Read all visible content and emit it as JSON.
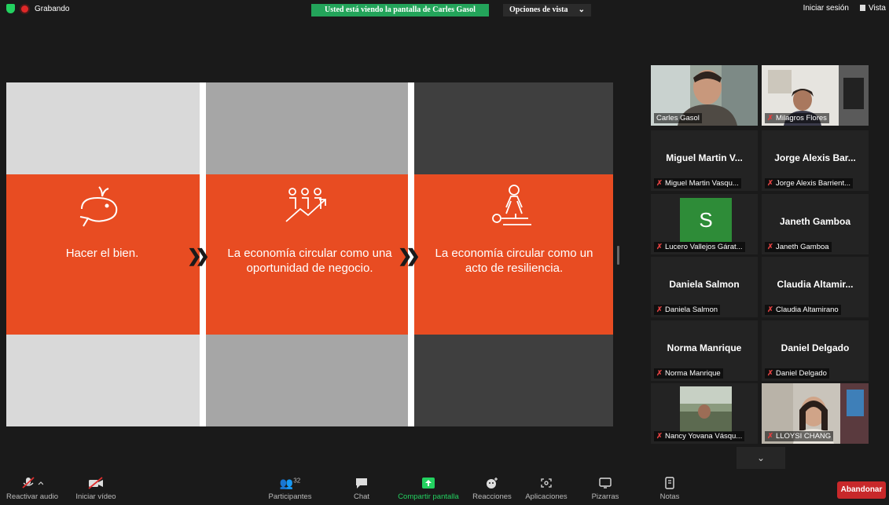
{
  "topbar": {
    "recording_label": "Grabando",
    "banner_text": "Usted está viendo la pantalla de Carles Gasol",
    "view_options_label": "Opciones de vista",
    "view_options_chevron": "⌄",
    "sign_in_label": "Iniciar sesión",
    "vista_label": "Vista"
  },
  "slide": {
    "panels": [
      {
        "text": "Hacer el bien.",
        "icon": "whale-icon"
      },
      {
        "text": "La economía circular como una oportunidad de negocio.",
        "icon": "growth-people-icon"
      },
      {
        "text": "La economía circular como un acto de resiliencia.",
        "icon": "cpr-icon"
      }
    ],
    "separator": "❯❯",
    "colors": {
      "accent": "#e84c22",
      "light": "#d9d9d9",
      "mid": "#a6a6a6",
      "dark": "#3f3f3f"
    }
  },
  "participants": [
    {
      "display": "",
      "label": "Carles Gasol",
      "video": true,
      "active": true
    },
    {
      "display": "",
      "label": "Milagros Flores",
      "video": true,
      "muted": true
    },
    {
      "display": "Miguel Martin V...",
      "label": "Miguel Martin Vasqu...",
      "muted": true
    },
    {
      "display": "Jorge Alexis Bar...",
      "label": "Jorge Alexis Barrient...",
      "muted": true
    },
    {
      "display": "S",
      "label": "Lucero Vallejos Gárat...",
      "avatar": true,
      "muted": true
    },
    {
      "display": "Janeth Gamboa",
      "label": "Janeth Gamboa",
      "muted": true
    },
    {
      "display": "Daniela Salmon",
      "label": "Daniela Salmon",
      "muted": true
    },
    {
      "display": "Claudia  Altamir...",
      "label": "Claudia Altamirano",
      "muted": true
    },
    {
      "display": "Norma Manrique",
      "label": "Norma Manrique",
      "muted": true
    },
    {
      "display": "Daniel Delgado",
      "label": "Daniel Delgado",
      "muted": true
    },
    {
      "display": "",
      "label": "Nancy Yovana Vásqu...",
      "video": true,
      "muted": true
    },
    {
      "display": "",
      "label": "LLOYSI CHANG",
      "video": true,
      "muted": true
    }
  ],
  "scroll_down": "⌄",
  "toolbar": {
    "unmute": "Reactivar audio",
    "start_video": "Iniciar vídeo",
    "participants": "Participantes",
    "participants_count": "32",
    "chat": "Chat",
    "share_screen": "Compartir pantalla",
    "reactions": "Reacciones",
    "apps": "Aplicaciones",
    "whiteboards": "Pizarras",
    "notes": "Notas",
    "leave": "Abandonar"
  },
  "icons": [
    "shield-icon",
    "record-icon",
    "mic-muted-icon",
    "video-off-icon",
    "participants-icon",
    "chat-icon",
    "share-icon",
    "reactions-icon",
    "apps-icon",
    "whiteboard-icon",
    "notes-icon"
  ]
}
